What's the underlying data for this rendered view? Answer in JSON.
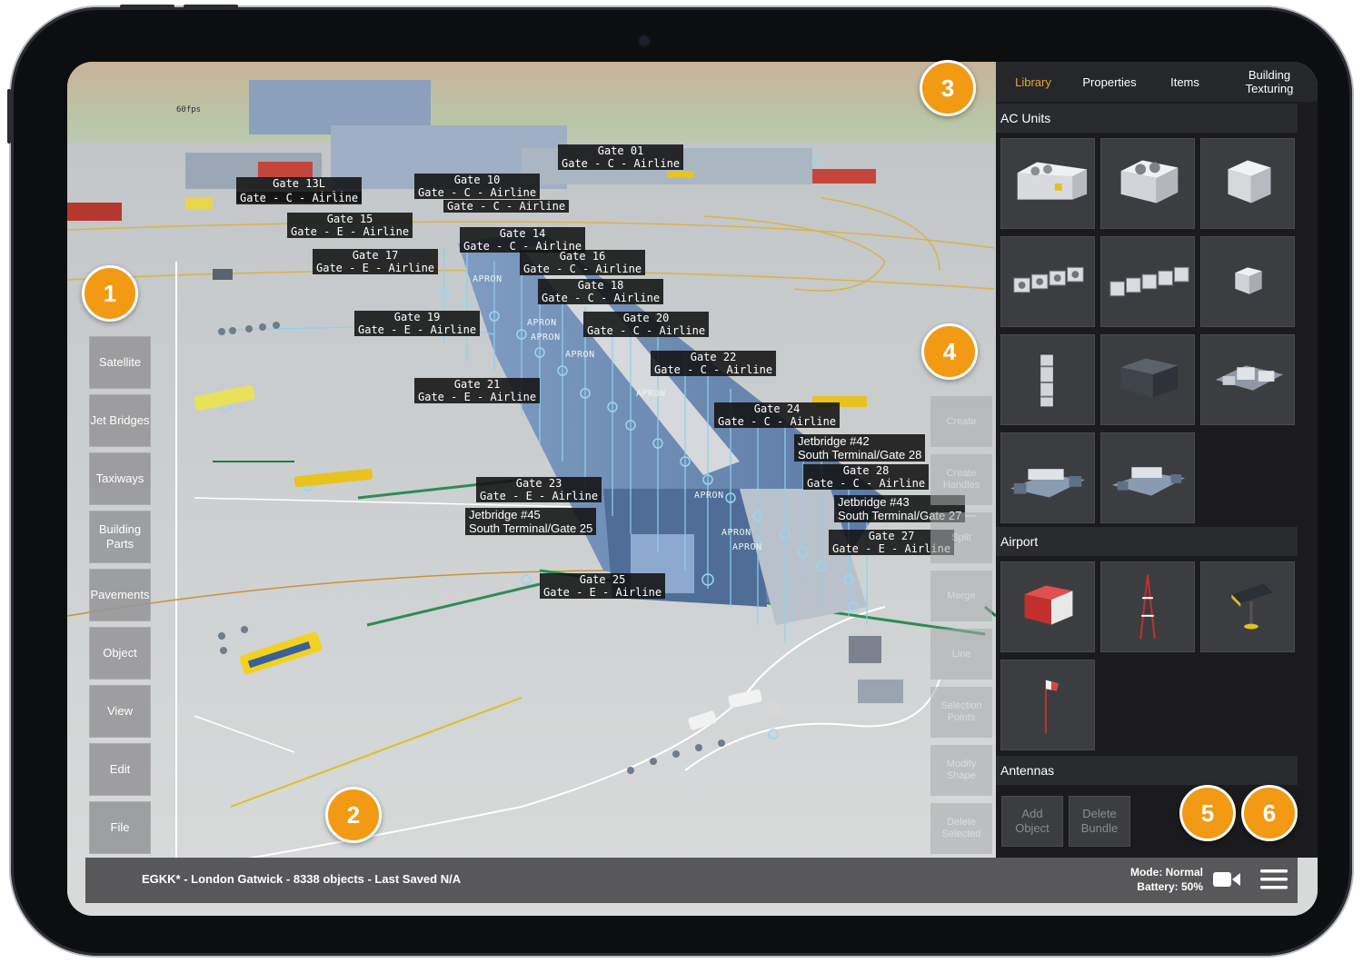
{
  "viewport": {
    "fps": "60fps"
  },
  "left_nav": [
    {
      "label": "Satellite"
    },
    {
      "label": "Jet Bridges"
    },
    {
      "label": "Taxiways"
    },
    {
      "label": "Building\nParts"
    },
    {
      "label": "Pavements"
    },
    {
      "label": "Object"
    },
    {
      "label": "View"
    },
    {
      "label": "Edit"
    },
    {
      "label": "File"
    }
  ],
  "gate_tags": [
    "Gate 01\nGate - C - Airline",
    "Gate 13L\nGate - C - Airline",
    "Gate 10\nGate - C - Airline",
    "Gate - C - Airline",
    "Gate 15\nGate - E - Airline",
    "Gate - C - Airline",
    "Gate 14\nGate - C - Airline",
    "Gate 16\nGate - C - Airline",
    "Gate 17\nGate - E - Airline",
    "Gate 18\nGate - C - Airline",
    "Gate 19\nGate - E - Airline",
    "Gate 20\nGate - C - Airline",
    "Gate 22\nGate - C - Airline",
    "Gate 21\nGate - E - Airline",
    "Gate 24\nGate - C - Airline",
    "Gate 28\nGate - C - Airline",
    "Gate 23\nGate - E - Airline",
    "Gate 27\nGate - E - Airline",
    "Gate 25\nGate - E - Airline"
  ],
  "jetbridge_tags": [
    "Jetbridge #42\nSouth Terminal/Gate 28",
    "Jetbridge #43\nSouth Terminal/Gate 27",
    "Jetbridge #45\nSouth Terminal/Gate 25"
  ],
  "apron_labels": [
    "APRON",
    "APRON",
    "APRON",
    "APRON",
    "APRON",
    "APRON",
    "APRON",
    "APRON"
  ],
  "right_tools": [
    {
      "label": "Create"
    },
    {
      "label": "Create\nHandles"
    },
    {
      "label": "Split"
    },
    {
      "label": "Merge"
    },
    {
      "label": "Line"
    },
    {
      "label": "Selection\nPoints"
    },
    {
      "label": "Modify\nShape"
    },
    {
      "label": "Delete\nSelected"
    }
  ],
  "panel": {
    "tabs": [
      {
        "label": "Library",
        "active": true
      },
      {
        "label": "Properties",
        "active": false
      },
      {
        "label": "Items",
        "active": false
      },
      {
        "label": "Building\nTexturing",
        "active": false
      }
    ],
    "sections": [
      {
        "title": "AC Units",
        "tiles": [
          "ac-unit-large-icon",
          "ac-unit-twin-fan-icon",
          "ac-unit-box-icon",
          "ac-unit-row-4-icon",
          "ac-unit-row-5-icon",
          "ac-unit-small-icon",
          "ac-unit-vertical-stack-icon",
          "ac-unit-dark-box-icon",
          "ac-unit-cluster-icon",
          "ac-unit-frame-icon",
          "ac-unit-frame-2-icon"
        ]
      },
      {
        "title": "Airport",
        "tiles": [
          "container-icon",
          "radio-mast-icon",
          "sign-light-icon",
          "windsock-icon"
        ]
      },
      {
        "title": "Antennas",
        "tiles": []
      }
    ],
    "add_object": "Add\nObject",
    "delete_bundle": "Delete\nBundle"
  },
  "status": {
    "project": "EGKK* - London Gatwick - 8338 objects - Last Saved N/A",
    "mode": "Mode: Normal",
    "battery": "Battery: 50%"
  },
  "badges": [
    "1",
    "2",
    "3",
    "4",
    "5",
    "6"
  ],
  "colors": {
    "accent": "#f29a14",
    "active_tab": "#e3a634",
    "jetbridge_lines": "#8fd0ee"
  }
}
